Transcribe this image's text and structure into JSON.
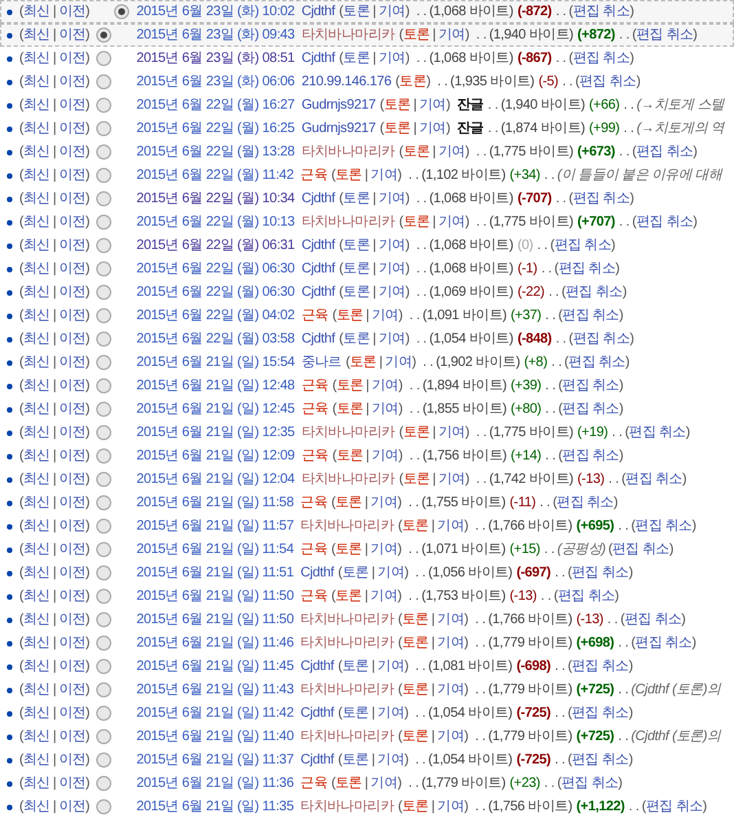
{
  "punctuation": {
    "open": "(",
    "close": ")",
    "pipe": "|",
    "dots": ". ."
  },
  "rows": [
    {
      "kind": "current",
      "highlighted": true,
      "selected": true,
      "current": "최신",
      "previous": "이전",
      "date": "2015년 6월 23일 (화) 10:02",
      "date_visited": false,
      "user": {
        "text": "Cjdthf",
        "kind": "existing"
      },
      "talk": {
        "text": "토론",
        "kind": "existing"
      },
      "contribs": "기여",
      "size": "(1,068 바이트)",
      "diff": {
        "text": "(-872)",
        "kind": "minus",
        "bold": true
      },
      "undo": "편집 취소"
    },
    {
      "kind": "past",
      "highlighted": true,
      "selected": true,
      "current": "최신",
      "previous": "이전",
      "date": "2015년 6월 23일 (화) 09:43",
      "date_visited": false,
      "user": {
        "text": "타치바나마리카",
        "kind": "visited"
      },
      "talk": {
        "text": "토론",
        "kind": "missing"
      },
      "contribs": "기여",
      "size": "(1,940 바이트)",
      "diff": {
        "text": "(+872)",
        "kind": "plus",
        "bold": true
      },
      "undo": "편집 취소"
    },
    {
      "kind": "past",
      "highlighted": false,
      "selected": false,
      "current": "최신",
      "previous": "이전",
      "date": "2015년 6월 23일 (화) 08:51",
      "date_visited": true,
      "user": {
        "text": "Cjdthf",
        "kind": "existing"
      },
      "talk": {
        "text": "토론",
        "kind": "existing"
      },
      "contribs": "기여",
      "size": "(1,068 바이트)",
      "diff": {
        "text": "(-867)",
        "kind": "minus",
        "bold": true
      },
      "undo": "편집 취소"
    },
    {
      "kind": "past",
      "highlighted": false,
      "selected": false,
      "current": "최신",
      "previous": "이전",
      "date": "2015년 6월 23일 (화) 06:06",
      "date_visited": false,
      "user": {
        "text": "210.99.146.176",
        "kind": "existing"
      },
      "talk": {
        "text": "토론",
        "kind": "missing"
      },
      "size": "(1,935 바이트)",
      "diff": {
        "text": "(-5)",
        "kind": "minus",
        "bold": false
      },
      "undo": "편집 취소"
    },
    {
      "kind": "past",
      "highlighted": false,
      "selected": false,
      "current": "최신",
      "previous": "이전",
      "date": "2015년 6월 22일 (월) 16:27",
      "date_visited": false,
      "user": {
        "text": "Gudrnjs9217",
        "kind": "existing"
      },
      "talk": {
        "text": "토론",
        "kind": "missing"
      },
      "contribs": "기여",
      "minor": "잔글",
      "size": "(1,940 바이트)",
      "diff": {
        "text": "(+66)",
        "kind": "plus",
        "bold": false
      },
      "comment": "(→치토게 스텔"
    },
    {
      "kind": "past",
      "highlighted": false,
      "selected": false,
      "current": "최신",
      "previous": "이전",
      "date": "2015년 6월 22일 (월) 16:25",
      "date_visited": false,
      "user": {
        "text": "Gudrnjs9217",
        "kind": "existing"
      },
      "talk": {
        "text": "토론",
        "kind": "missing"
      },
      "contribs": "기여",
      "minor": "잔글",
      "size": "(1,874 바이트)",
      "diff": {
        "text": "(+99)",
        "kind": "plus",
        "bold": false
      },
      "comment": "(→치토게의 역"
    },
    {
      "kind": "past",
      "highlighted": false,
      "selected": false,
      "current": "최신",
      "previous": "이전",
      "date": "2015년 6월 22일 (월) 13:28",
      "date_visited": false,
      "user": {
        "text": "타치바나마리카",
        "kind": "visited"
      },
      "talk": {
        "text": "토론",
        "kind": "missing"
      },
      "contribs": "기여",
      "size": "(1,775 바이트)",
      "diff": {
        "text": "(+673)",
        "kind": "plus",
        "bold": true
      },
      "undo": "편집 취소"
    },
    {
      "kind": "past",
      "highlighted": false,
      "selected": false,
      "current": "최신",
      "previous": "이전",
      "date": "2015년 6월 22일 (월) 11:42",
      "date_visited": false,
      "user": {
        "text": "근육",
        "kind": "missing"
      },
      "talk": {
        "text": "토론",
        "kind": "missing"
      },
      "contribs": "기여",
      "size": "(1,102 바이트)",
      "diff": {
        "text": "(+34)",
        "kind": "plus",
        "bold": false
      },
      "comment": "(이 틀들이 붙은 이유에 대해"
    },
    {
      "kind": "past",
      "highlighted": false,
      "selected": false,
      "current": "최신",
      "previous": "이전",
      "date": "2015년 6월 22일 (월) 10:34",
      "date_visited": true,
      "user": {
        "text": "Cjdthf",
        "kind": "existing"
      },
      "talk": {
        "text": "토론",
        "kind": "existing"
      },
      "contribs": "기여",
      "size": "(1,068 바이트)",
      "diff": {
        "text": "(-707)",
        "kind": "minus",
        "bold": true
      },
      "undo": "편집 취소"
    },
    {
      "kind": "past",
      "highlighted": false,
      "selected": false,
      "current": "최신",
      "previous": "이전",
      "date": "2015년 6월 22일 (월) 10:13",
      "date_visited": false,
      "user": {
        "text": "타치바나마리카",
        "kind": "visited"
      },
      "talk": {
        "text": "토론",
        "kind": "missing"
      },
      "contribs": "기여",
      "size": "(1,775 바이트)",
      "diff": {
        "text": "(+707)",
        "kind": "plus",
        "bold": true
      },
      "undo": "편집 취소"
    },
    {
      "kind": "past",
      "highlighted": false,
      "selected": false,
      "current": "최신",
      "previous": "이전",
      "date": "2015년 6월 22일 (월) 06:31",
      "date_visited": true,
      "user": {
        "text": "Cjdthf",
        "kind": "existing"
      },
      "talk": {
        "text": "토론",
        "kind": "existing"
      },
      "contribs": "기여",
      "size": "(1,068 바이트)",
      "diff": {
        "text": "(0)",
        "kind": "zero",
        "bold": false
      },
      "undo": "편집 취소"
    },
    {
      "kind": "past",
      "highlighted": false,
      "selected": false,
      "current": "최신",
      "previous": "이전",
      "date": "2015년 6월 22일 (월) 06:30",
      "date_visited": false,
      "user": {
        "text": "Cjdthf",
        "kind": "existing"
      },
      "talk": {
        "text": "토론",
        "kind": "existing"
      },
      "contribs": "기여",
      "size": "(1,068 바이트)",
      "diff": {
        "text": "(-1)",
        "kind": "minus",
        "bold": false
      },
      "undo": "편집 취소"
    },
    {
      "kind": "past",
      "highlighted": false,
      "selected": false,
      "current": "최신",
      "previous": "이전",
      "date": "2015년 6월 22일 (월) 06:30",
      "date_visited": false,
      "user": {
        "text": "Cjdthf",
        "kind": "existing"
      },
      "talk": {
        "text": "토론",
        "kind": "existing"
      },
      "contribs": "기여",
      "size": "(1,069 바이트)",
      "diff": {
        "text": "(-22)",
        "kind": "minus",
        "bold": false
      },
      "undo": "편집 취소"
    },
    {
      "kind": "past",
      "highlighted": false,
      "selected": false,
      "current": "최신",
      "previous": "이전",
      "date": "2015년 6월 22일 (월) 04:02",
      "date_visited": false,
      "user": {
        "text": "근육",
        "kind": "missing"
      },
      "talk": {
        "text": "토론",
        "kind": "missing"
      },
      "contribs": "기여",
      "size": "(1,091 바이트)",
      "diff": {
        "text": "(+37)",
        "kind": "plus",
        "bold": false
      },
      "undo": "편집 취소"
    },
    {
      "kind": "past",
      "highlighted": false,
      "selected": false,
      "current": "최신",
      "previous": "이전",
      "date": "2015년 6월 22일 (월) 03:58",
      "date_visited": false,
      "user": {
        "text": "Cjdthf",
        "kind": "existing"
      },
      "talk": {
        "text": "토론",
        "kind": "existing"
      },
      "contribs": "기여",
      "size": "(1,054 바이트)",
      "diff": {
        "text": "(-848)",
        "kind": "minus",
        "bold": true
      },
      "undo": "편집 취소"
    },
    {
      "kind": "past",
      "highlighted": false,
      "selected": false,
      "current": "최신",
      "previous": "이전",
      "date": "2015년 6월 21일 (일) 15:54",
      "date_visited": false,
      "user": {
        "text": "중나르",
        "kind": "existing"
      },
      "talk": {
        "text": "토론",
        "kind": "missing"
      },
      "contribs": "기여",
      "size": "(1,902 바이트)",
      "diff": {
        "text": "(+8)",
        "kind": "plus",
        "bold": false
      },
      "undo": "편집 취소"
    },
    {
      "kind": "past",
      "highlighted": false,
      "selected": false,
      "current": "최신",
      "previous": "이전",
      "date": "2015년 6월 21일 (일) 12:48",
      "date_visited": false,
      "user": {
        "text": "근육",
        "kind": "missing"
      },
      "talk": {
        "text": "토론",
        "kind": "missing"
      },
      "contribs": "기여",
      "size": "(1,894 바이트)",
      "diff": {
        "text": "(+39)",
        "kind": "plus",
        "bold": false
      },
      "undo": "편집 취소"
    },
    {
      "kind": "past",
      "highlighted": false,
      "selected": false,
      "current": "최신",
      "previous": "이전",
      "date": "2015년 6월 21일 (일) 12:45",
      "date_visited": false,
      "user": {
        "text": "근육",
        "kind": "missing"
      },
      "talk": {
        "text": "토론",
        "kind": "missing"
      },
      "contribs": "기여",
      "size": "(1,855 바이트)",
      "diff": {
        "text": "(+80)",
        "kind": "plus",
        "bold": false
      },
      "undo": "편집 취소"
    },
    {
      "kind": "past",
      "highlighted": false,
      "selected": false,
      "current": "최신",
      "previous": "이전",
      "date": "2015년 6월 21일 (일) 12:35",
      "date_visited": false,
      "user": {
        "text": "타치바나마리카",
        "kind": "visited"
      },
      "talk": {
        "text": "토론",
        "kind": "missing"
      },
      "contribs": "기여",
      "size": "(1,775 바이트)",
      "diff": {
        "text": "(+19)",
        "kind": "plus",
        "bold": false
      },
      "undo": "편집 취소"
    },
    {
      "kind": "past",
      "highlighted": false,
      "selected": false,
      "current": "최신",
      "previous": "이전",
      "date": "2015년 6월 21일 (일) 12:09",
      "date_visited": false,
      "user": {
        "text": "근육",
        "kind": "missing"
      },
      "talk": {
        "text": "토론",
        "kind": "missing"
      },
      "contribs": "기여",
      "size": "(1,756 바이트)",
      "diff": {
        "text": "(+14)",
        "kind": "plus",
        "bold": false
      },
      "undo": "편집 취소"
    },
    {
      "kind": "past",
      "highlighted": false,
      "selected": false,
      "current": "최신",
      "previous": "이전",
      "date": "2015년 6월 21일 (일) 12:04",
      "date_visited": false,
      "user": {
        "text": "타치바나마리카",
        "kind": "visited"
      },
      "talk": {
        "text": "토론",
        "kind": "missing"
      },
      "contribs": "기여",
      "size": "(1,742 바이트)",
      "diff": {
        "text": "(-13)",
        "kind": "minus",
        "bold": false
      },
      "undo": "편집 취소"
    },
    {
      "kind": "past",
      "highlighted": false,
      "selected": false,
      "current": "최신",
      "previous": "이전",
      "date": "2015년 6월 21일 (일) 11:58",
      "date_visited": false,
      "user": {
        "text": "근육",
        "kind": "missing"
      },
      "talk": {
        "text": "토론",
        "kind": "missing"
      },
      "contribs": "기여",
      "size": "(1,755 바이트)",
      "diff": {
        "text": "(-11)",
        "kind": "minus",
        "bold": false
      },
      "undo": "편집 취소"
    },
    {
      "kind": "past",
      "highlighted": false,
      "selected": false,
      "current": "최신",
      "previous": "이전",
      "date": "2015년 6월 21일 (일) 11:57",
      "date_visited": false,
      "user": {
        "text": "타치바나마리카",
        "kind": "visited"
      },
      "talk": {
        "text": "토론",
        "kind": "missing"
      },
      "contribs": "기여",
      "size": "(1,766 바이트)",
      "diff": {
        "text": "(+695)",
        "kind": "plus",
        "bold": true
      },
      "undo": "편집 취소"
    },
    {
      "kind": "past",
      "highlighted": false,
      "selected": false,
      "current": "최신",
      "previous": "이전",
      "date": "2015년 6월 21일 (일) 11:54",
      "date_visited": false,
      "user": {
        "text": "근육",
        "kind": "missing"
      },
      "talk": {
        "text": "토론",
        "kind": "missing"
      },
      "contribs": "기여",
      "size": "(1,071 바이트)",
      "diff": {
        "text": "(+15)",
        "kind": "plus",
        "bold": false
      },
      "comment": "(공평성)",
      "undo": "편집 취소"
    },
    {
      "kind": "past",
      "highlighted": false,
      "selected": false,
      "current": "최신",
      "previous": "이전",
      "date": "2015년 6월 21일 (일) 11:51",
      "date_visited": false,
      "user": {
        "text": "Cjdthf",
        "kind": "existing"
      },
      "talk": {
        "text": "토론",
        "kind": "existing"
      },
      "contribs": "기여",
      "size": "(1,056 바이트)",
      "diff": {
        "text": "(-697)",
        "kind": "minus",
        "bold": true
      },
      "undo": "편집 취소"
    },
    {
      "kind": "past",
      "highlighted": false,
      "selected": false,
      "current": "최신",
      "previous": "이전",
      "date": "2015년 6월 21일 (일) 11:50",
      "date_visited": false,
      "user": {
        "text": "근육",
        "kind": "missing"
      },
      "talk": {
        "text": "토론",
        "kind": "missing"
      },
      "contribs": "기여",
      "size": "(1,753 바이트)",
      "diff": {
        "text": "(-13)",
        "kind": "minus",
        "bold": false
      },
      "undo": "편집 취소"
    },
    {
      "kind": "past",
      "highlighted": false,
      "selected": false,
      "current": "최신",
      "previous": "이전",
      "date": "2015년 6월 21일 (일) 11:50",
      "date_visited": false,
      "user": {
        "text": "타치바나마리카",
        "kind": "visited"
      },
      "talk": {
        "text": "토론",
        "kind": "missing"
      },
      "contribs": "기여",
      "size": "(1,766 바이트)",
      "diff": {
        "text": "(-13)",
        "kind": "minus",
        "bold": false
      },
      "undo": "편집 취소"
    },
    {
      "kind": "past",
      "highlighted": false,
      "selected": false,
      "current": "최신",
      "previous": "이전",
      "date": "2015년 6월 21일 (일) 11:46",
      "date_visited": false,
      "user": {
        "text": "타치바나마리카",
        "kind": "visited"
      },
      "talk": {
        "text": "토론",
        "kind": "missing"
      },
      "contribs": "기여",
      "size": "(1,779 바이트)",
      "diff": {
        "text": "(+698)",
        "kind": "plus",
        "bold": true
      },
      "undo": "편집 취소"
    },
    {
      "kind": "past",
      "highlighted": false,
      "selected": false,
      "current": "최신",
      "previous": "이전",
      "date": "2015년 6월 21일 (일) 11:45",
      "date_visited": false,
      "user": {
        "text": "Cjdthf",
        "kind": "existing"
      },
      "talk": {
        "text": "토론",
        "kind": "existing"
      },
      "contribs": "기여",
      "size": "(1,081 바이트)",
      "diff": {
        "text": "(-698)",
        "kind": "minus",
        "bold": true
      },
      "undo": "편집 취소"
    },
    {
      "kind": "past",
      "highlighted": false,
      "selected": false,
      "current": "최신",
      "previous": "이전",
      "date": "2015년 6월 21일 (일) 11:43",
      "date_visited": false,
      "user": {
        "text": "타치바나마리카",
        "kind": "visited"
      },
      "talk": {
        "text": "토론",
        "kind": "missing"
      },
      "contribs": "기여",
      "size": "(1,779 바이트)",
      "diff": {
        "text": "(+725)",
        "kind": "plus",
        "bold": true
      },
      "comment": "(Cjdthf (토론)의"
    },
    {
      "kind": "past",
      "highlighted": false,
      "selected": false,
      "current": "최신",
      "previous": "이전",
      "date": "2015년 6월 21일 (일) 11:42",
      "date_visited": false,
      "user": {
        "text": "Cjdthf",
        "kind": "existing"
      },
      "talk": {
        "text": "토론",
        "kind": "existing"
      },
      "contribs": "기여",
      "size": "(1,054 바이트)",
      "diff": {
        "text": "(-725)",
        "kind": "minus",
        "bold": true
      },
      "undo": "편집 취소"
    },
    {
      "kind": "past",
      "highlighted": false,
      "selected": false,
      "current": "최신",
      "previous": "이전",
      "date": "2015년 6월 21일 (일) 11:40",
      "date_visited": false,
      "user": {
        "text": "타치바나마리카",
        "kind": "visited"
      },
      "talk": {
        "text": "토론",
        "kind": "missing"
      },
      "contribs": "기여",
      "size": "(1,779 바이트)",
      "diff": {
        "text": "(+725)",
        "kind": "plus",
        "bold": true
      },
      "comment": "(Cjdthf (토론)의"
    },
    {
      "kind": "past",
      "highlighted": false,
      "selected": false,
      "current": "최신",
      "previous": "이전",
      "date": "2015년 6월 21일 (일) 11:37",
      "date_visited": false,
      "user": {
        "text": "Cjdthf",
        "kind": "existing"
      },
      "talk": {
        "text": "토론",
        "kind": "existing"
      },
      "contribs": "기여",
      "size": "(1,054 바이트)",
      "diff": {
        "text": "(-725)",
        "kind": "minus",
        "bold": true
      },
      "undo": "편집 취소"
    },
    {
      "kind": "past",
      "highlighted": false,
      "selected": false,
      "current": "최신",
      "previous": "이전",
      "date": "2015년 6월 21일 (일) 11:36",
      "date_visited": false,
      "user": {
        "text": "근육",
        "kind": "missing"
      },
      "talk": {
        "text": "토론",
        "kind": "missing"
      },
      "contribs": "기여",
      "size": "(1,779 바이트)",
      "diff": {
        "text": "(+23)",
        "kind": "plus",
        "bold": false
      },
      "undo": "편집 취소"
    },
    {
      "kind": "past",
      "highlighted": false,
      "selected": false,
      "current": "최신",
      "previous": "이전",
      "date": "2015년 6월 21일 (일) 11:35",
      "date_visited": false,
      "user": {
        "text": "타치바나마리카",
        "kind": "visited"
      },
      "talk": {
        "text": "토론",
        "kind": "missing"
      },
      "contribs": "기여",
      "size": "(1,756 바이트)",
      "diff": {
        "text": "(+1,122)",
        "kind": "plus",
        "bold": true
      },
      "undo": "편집 취소"
    }
  ]
}
